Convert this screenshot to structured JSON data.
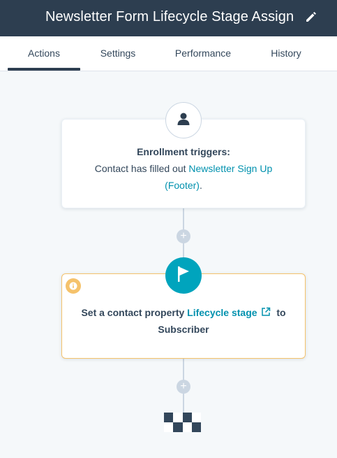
{
  "header": {
    "title": "Newsletter Form Lifecycle Stage Assign"
  },
  "tabs": [
    {
      "label": "Actions",
      "active": true
    },
    {
      "label": "Settings",
      "active": false
    },
    {
      "label": "Performance",
      "active": false
    },
    {
      "label": "History",
      "active": false
    }
  ],
  "enrollment": {
    "heading": "Enrollment triggers:",
    "prefix": "Contact has filled out ",
    "form_link_line1": "Newsletter Sign Up",
    "form_link_line2": "(Footer)",
    "suffix": "."
  },
  "action": {
    "prefix": "Set a contact property ",
    "property_link": "Lifecycle stage",
    "to": "to",
    "value": "Subscriber"
  },
  "add_button": {
    "label": "+"
  },
  "colors": {
    "header_bg": "#2d3e50",
    "accent_teal": "#00a4bd",
    "link": "#0091ae",
    "warning": "#f5c26b"
  },
  "icons": [
    "edit-pencil-icon",
    "contact-avatar-icon",
    "flag-icon",
    "info-icon",
    "external-link-icon",
    "end-checkered-flag-icon"
  ]
}
